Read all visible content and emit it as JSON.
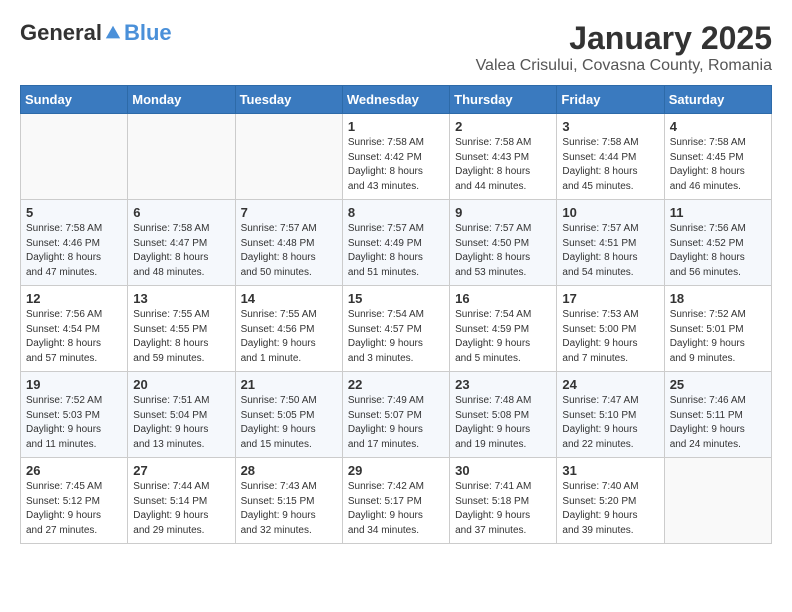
{
  "header": {
    "logo_general": "General",
    "logo_blue": "Blue",
    "month_title": "January 2025",
    "location": "Valea Crisului, Covasna County, Romania"
  },
  "weekdays": [
    "Sunday",
    "Monday",
    "Tuesday",
    "Wednesday",
    "Thursday",
    "Friday",
    "Saturday"
  ],
  "weeks": [
    [
      {
        "day": "",
        "info": ""
      },
      {
        "day": "",
        "info": ""
      },
      {
        "day": "",
        "info": ""
      },
      {
        "day": "1",
        "info": "Sunrise: 7:58 AM\nSunset: 4:42 PM\nDaylight: 8 hours\nand 43 minutes."
      },
      {
        "day": "2",
        "info": "Sunrise: 7:58 AM\nSunset: 4:43 PM\nDaylight: 8 hours\nand 44 minutes."
      },
      {
        "day": "3",
        "info": "Sunrise: 7:58 AM\nSunset: 4:44 PM\nDaylight: 8 hours\nand 45 minutes."
      },
      {
        "day": "4",
        "info": "Sunrise: 7:58 AM\nSunset: 4:45 PM\nDaylight: 8 hours\nand 46 minutes."
      }
    ],
    [
      {
        "day": "5",
        "info": "Sunrise: 7:58 AM\nSunset: 4:46 PM\nDaylight: 8 hours\nand 47 minutes."
      },
      {
        "day": "6",
        "info": "Sunrise: 7:58 AM\nSunset: 4:47 PM\nDaylight: 8 hours\nand 48 minutes."
      },
      {
        "day": "7",
        "info": "Sunrise: 7:57 AM\nSunset: 4:48 PM\nDaylight: 8 hours\nand 50 minutes."
      },
      {
        "day": "8",
        "info": "Sunrise: 7:57 AM\nSunset: 4:49 PM\nDaylight: 8 hours\nand 51 minutes."
      },
      {
        "day": "9",
        "info": "Sunrise: 7:57 AM\nSunset: 4:50 PM\nDaylight: 8 hours\nand 53 minutes."
      },
      {
        "day": "10",
        "info": "Sunrise: 7:57 AM\nSunset: 4:51 PM\nDaylight: 8 hours\nand 54 minutes."
      },
      {
        "day": "11",
        "info": "Sunrise: 7:56 AM\nSunset: 4:52 PM\nDaylight: 8 hours\nand 56 minutes."
      }
    ],
    [
      {
        "day": "12",
        "info": "Sunrise: 7:56 AM\nSunset: 4:54 PM\nDaylight: 8 hours\nand 57 minutes."
      },
      {
        "day": "13",
        "info": "Sunrise: 7:55 AM\nSunset: 4:55 PM\nDaylight: 8 hours\nand 59 minutes."
      },
      {
        "day": "14",
        "info": "Sunrise: 7:55 AM\nSunset: 4:56 PM\nDaylight: 9 hours\nand 1 minute."
      },
      {
        "day": "15",
        "info": "Sunrise: 7:54 AM\nSunset: 4:57 PM\nDaylight: 9 hours\nand 3 minutes."
      },
      {
        "day": "16",
        "info": "Sunrise: 7:54 AM\nSunset: 4:59 PM\nDaylight: 9 hours\nand 5 minutes."
      },
      {
        "day": "17",
        "info": "Sunrise: 7:53 AM\nSunset: 5:00 PM\nDaylight: 9 hours\nand 7 minutes."
      },
      {
        "day": "18",
        "info": "Sunrise: 7:52 AM\nSunset: 5:01 PM\nDaylight: 9 hours\nand 9 minutes."
      }
    ],
    [
      {
        "day": "19",
        "info": "Sunrise: 7:52 AM\nSunset: 5:03 PM\nDaylight: 9 hours\nand 11 minutes."
      },
      {
        "day": "20",
        "info": "Sunrise: 7:51 AM\nSunset: 5:04 PM\nDaylight: 9 hours\nand 13 minutes."
      },
      {
        "day": "21",
        "info": "Sunrise: 7:50 AM\nSunset: 5:05 PM\nDaylight: 9 hours\nand 15 minutes."
      },
      {
        "day": "22",
        "info": "Sunrise: 7:49 AM\nSunset: 5:07 PM\nDaylight: 9 hours\nand 17 minutes."
      },
      {
        "day": "23",
        "info": "Sunrise: 7:48 AM\nSunset: 5:08 PM\nDaylight: 9 hours\nand 19 minutes."
      },
      {
        "day": "24",
        "info": "Sunrise: 7:47 AM\nSunset: 5:10 PM\nDaylight: 9 hours\nand 22 minutes."
      },
      {
        "day": "25",
        "info": "Sunrise: 7:46 AM\nSunset: 5:11 PM\nDaylight: 9 hours\nand 24 minutes."
      }
    ],
    [
      {
        "day": "26",
        "info": "Sunrise: 7:45 AM\nSunset: 5:12 PM\nDaylight: 9 hours\nand 27 minutes."
      },
      {
        "day": "27",
        "info": "Sunrise: 7:44 AM\nSunset: 5:14 PM\nDaylight: 9 hours\nand 29 minutes."
      },
      {
        "day": "28",
        "info": "Sunrise: 7:43 AM\nSunset: 5:15 PM\nDaylight: 9 hours\nand 32 minutes."
      },
      {
        "day": "29",
        "info": "Sunrise: 7:42 AM\nSunset: 5:17 PM\nDaylight: 9 hours\nand 34 minutes."
      },
      {
        "day": "30",
        "info": "Sunrise: 7:41 AM\nSunset: 5:18 PM\nDaylight: 9 hours\nand 37 minutes."
      },
      {
        "day": "31",
        "info": "Sunrise: 7:40 AM\nSunset: 5:20 PM\nDaylight: 9 hours\nand 39 minutes."
      },
      {
        "day": "",
        "info": ""
      }
    ]
  ]
}
